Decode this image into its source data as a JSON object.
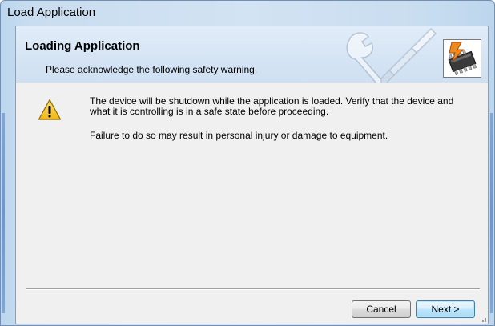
{
  "window": {
    "title": "Load Application"
  },
  "banner": {
    "title": "Loading Application",
    "subtitle": "Please acknowledge the following safety warning.",
    "graphic_icon": "wrench-screwdriver-icon",
    "chip_icon": "chip-lightning-icon"
  },
  "message": {
    "icon": "warning-icon",
    "paragraph1": "The device will be shutdown while the application is loaded.  Verify that the device and what it is controlling is in a safe state before proceeding.",
    "paragraph2": "Failure to do so may result in personal injury or damage to equipment."
  },
  "buttons": {
    "cancel_label": "Cancel",
    "next_label": "Next >"
  },
  "colors": {
    "frame": "#c9ddf0",
    "banner": "#d5e4f4",
    "client": "#f0f0f0",
    "default_button_border": "#3c7fb1",
    "warning_fill": "#f7c72b"
  }
}
